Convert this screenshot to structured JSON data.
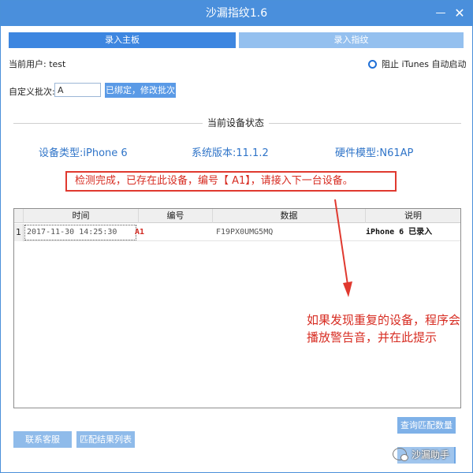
{
  "window": {
    "title": "沙漏指纹1.6",
    "minimize_glyph": "—",
    "close_glyph": "✕"
  },
  "tabs": [
    {
      "label": "录入主板",
      "active": true
    },
    {
      "label": "录入指纹",
      "active": false
    }
  ],
  "user": {
    "label": "当前用户: test"
  },
  "itunes_option": {
    "label": "阻止 iTunes 自动启动",
    "checked": true
  },
  "batch": {
    "label": "自定义批次:",
    "value": "A",
    "button_label": "已绑定，修改批次"
  },
  "device_status": {
    "title": "当前设备状态",
    "type": "设备类型:iPhone 6",
    "version": "系统版本:11.1.2",
    "model": "硬件模型:N61AP",
    "message": "检测完成，已存在此设备，编号【 A1】，请接入下一台设备。"
  },
  "table": {
    "headers": [
      "时间",
      "编号",
      "数据",
      "说明"
    ],
    "rows": [
      {
        "index": "1",
        "time": "2017-11-30 14:25:30",
        "id": "A1",
        "data": "F19PX0UMG5MQ",
        "note": "iPhone 6 已录入"
      }
    ]
  },
  "annotation": "如果发现重复的设备，程序会播放警告音，并在此提示",
  "buttons": {
    "contact": "联系客服",
    "results": "匹配结果列表",
    "query": "查询匹配数量"
  },
  "watermark": {
    "text": "沙漏助手",
    "icon": "wechat-icon"
  },
  "colors": {
    "titlebar": "#4a8fdc",
    "active_tab": "#3d86e0",
    "inactive_tab": "#94c0ef",
    "device_text": "#2f74c8",
    "alert": "#d72c22"
  }
}
